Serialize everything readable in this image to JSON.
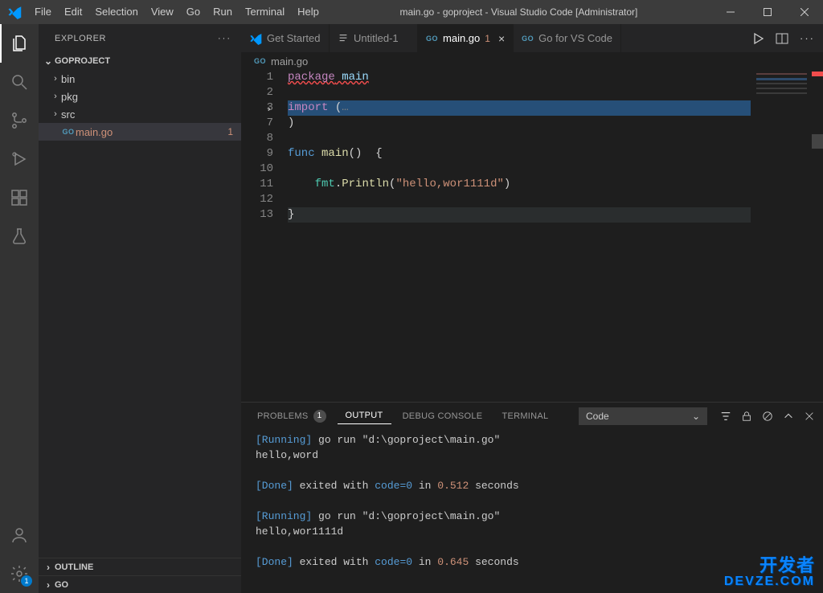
{
  "window": {
    "title": "main.go - goproject - Visual Studio Code [Administrator]"
  },
  "menus": [
    "File",
    "Edit",
    "Selection",
    "View",
    "Go",
    "Run",
    "Terminal",
    "Help"
  ],
  "activity": {
    "settings_badge": "1"
  },
  "sidebar": {
    "title": "EXPLORER",
    "project": "GOPROJECT",
    "folders": [
      "bin",
      "pkg",
      "src"
    ],
    "file": {
      "name": "main.go",
      "decor": "1"
    },
    "sections": [
      "OUTLINE",
      "GO"
    ]
  },
  "tabs": [
    {
      "label": "Get Started"
    },
    {
      "label": "Untitled-1"
    },
    {
      "label": "main.go",
      "modified": "1",
      "active": true
    },
    {
      "label": "Go for VS Code"
    }
  ],
  "breadcrumbs": {
    "file": "main.go"
  },
  "editor": {
    "line_numbers": [
      "1",
      "2",
      "3",
      "7",
      "8",
      "9",
      "10",
      "11",
      "12",
      "13"
    ],
    "l1_kw": "package",
    "l1_id": " main",
    "l3_kw": "import",
    "l3_rest": " (",
    "l3_dots": "…",
    "l7": ")",
    "l9_kw": "func",
    "l9_name": " main",
    "l9_rest": "()  {",
    "l11_pkg": "fmt",
    "l11_dot": ".",
    "l11_fn": "Println",
    "l11_paren": "(",
    "l11_str": "\"hello,wor1111d\"",
    "l11_close": ")",
    "l13": "}"
  },
  "panel": {
    "tabs": {
      "problems": "PROBLEMS",
      "problems_count": "1",
      "output": "OUTPUT",
      "debug": "DEBUG CONSOLE",
      "terminal": "TERMINAL"
    },
    "select": "Code",
    "lines": {
      "r1_tag": "[Running]",
      "r1_rest": " go run \"d:\\goproject\\main.go\"",
      "r2": "hello,word",
      "d1_tag": "[Done]",
      "d1_a": " exited with ",
      "d1_code": "code=0",
      "d1_b": " in ",
      "d1_t": "0.512",
      "d1_c": " seconds",
      "r3_tag": "[Running]",
      "r3_rest": " go run \"d:\\goproject\\main.go\"",
      "r4": "hello,wor1111d",
      "d2_tag": "[Done]",
      "d2_a": " exited with ",
      "d2_code": "code=0",
      "d2_b": " in ",
      "d2_t": "0.645",
      "d2_c": " seconds"
    }
  },
  "watermark": {
    "l1": "开发者",
    "l2": "DEVZE.COM"
  }
}
